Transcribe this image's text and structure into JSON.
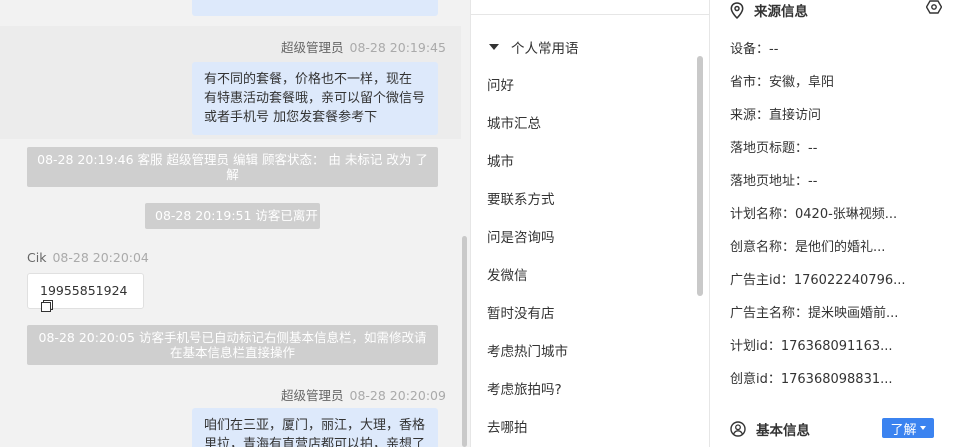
{
  "chat": {
    "msg1": {
      "name": "超级管理员",
      "time": "08-28 20:19:45",
      "lines": [
        "有不同的套餐，价格也不一样，现在",
        "有特惠活动套餐哦，亲可以留个微信号",
        "或者手机号 加您发套餐参考下"
      ]
    },
    "sys1": [
      "08-28 20:19:46 客服 超级管理员 编辑 顾客状态： 由 未标记 改为 了",
      "解"
    ],
    "sys2": "08-28 20:19:51 访客已离开",
    "visitor": {
      "name": "Cik",
      "time": "08-28 20:20:04",
      "phone": "19955851924"
    },
    "sys3": [
      "08-28 20:20:05 访客手机号已自动标记右侧基本信息栏，如需修改请",
      "在基本信息栏直接操作"
    ],
    "msg2": {
      "name": "超级管理员",
      "time": "08-28 20:20:09",
      "lines": [
        "咱们在三亚，厦门，丽江，大理，香格",
        "里拉，青海有直营店都可以拍，亲想了"
      ]
    }
  },
  "phrases": {
    "group": "个人常用语",
    "items": [
      "问好",
      "城市汇总",
      "城市",
      "要联系方式",
      "问是咨询吗",
      "发微信",
      "暂时没有店",
      "考虑热门城市",
      "考虑旅拍吗?",
      "去哪拍"
    ]
  },
  "info": {
    "source_title": "来源信息",
    "rows": [
      "设备：--",
      "省市：安徽，阜阳",
      "来源：直接访问",
      "落地页标题：--",
      "落地页地址：--",
      "计划名称：0420-张琳视频...",
      "创意名称：是他们的婚礼...",
      "广告主id：176022240796...",
      "广告主名称：提米映画婚前...",
      "计划id：176368091163...",
      "创意id：176368098831..."
    ],
    "basic_title": "基本信息",
    "status_button": "了解"
  },
  "icons": {
    "source": "location-pin-icon",
    "eye": "eye-settings-icon",
    "basic": "user-circle-icon",
    "copy": "copy-icon"
  },
  "colors": {
    "accent": "#3b83f0",
    "agent_bubble": "#dde9fb",
    "system_bg": "#cfcfcf"
  }
}
